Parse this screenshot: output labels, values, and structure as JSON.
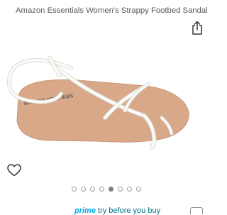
{
  "product": {
    "title": "Amazon Essentials Women's Strappy Footbed Sandal",
    "insole_brand": "amazon essentials"
  },
  "gallery": {
    "count": 8,
    "active_index": 4
  },
  "icons": {
    "share": "share-icon",
    "wishlist": "heart-icon"
  },
  "prime_banner": {
    "logo": "prime",
    "text": "try before you buy"
  },
  "colors": {
    "title_text": "#565959",
    "sole": "#d8a889",
    "straps": "#fbfbf8",
    "dot_active": "#7d8184",
    "prime_blue": "#00a8e1",
    "link_teal": "#007185"
  }
}
